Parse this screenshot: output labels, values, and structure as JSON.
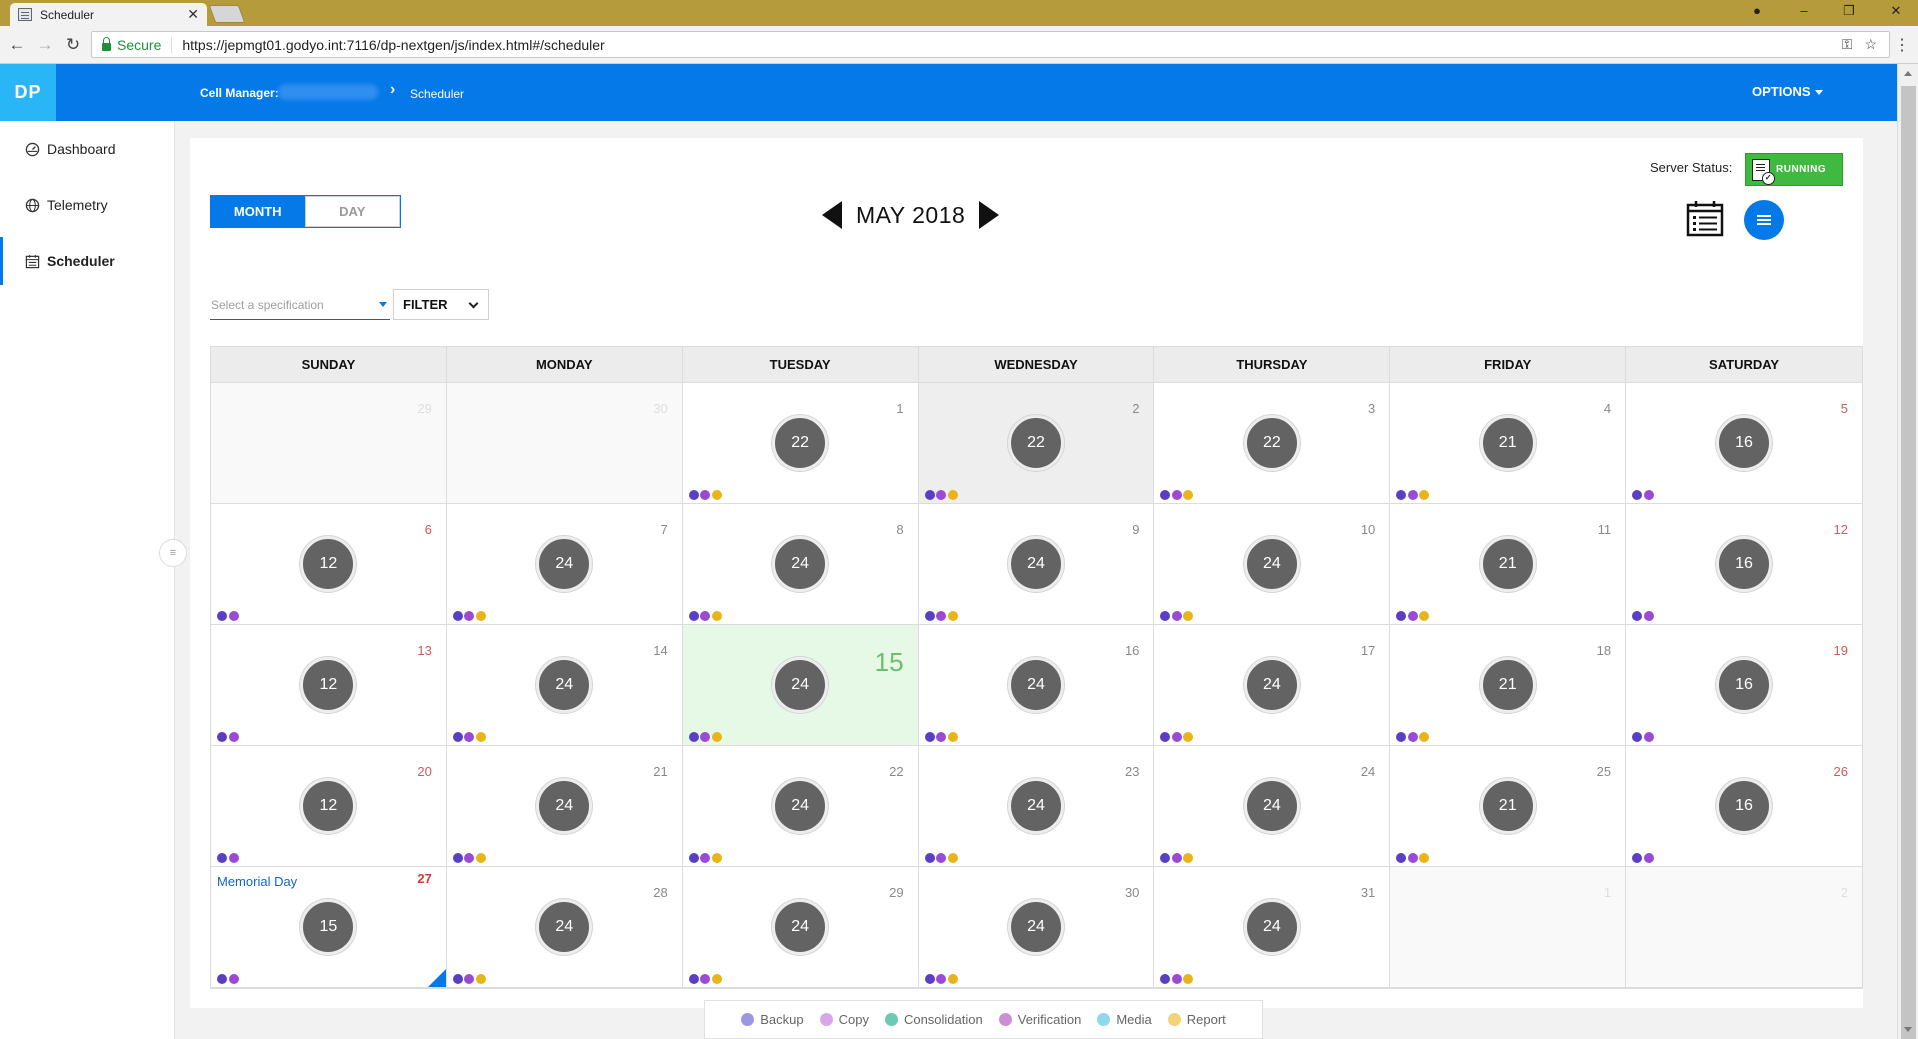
{
  "browser": {
    "tab_title": "Scheduler",
    "tab_close": "✕",
    "secure_label": "Secure",
    "url": "https://jepmgt01.godyo.int:7116/dp-nextgen/js/index.html#/scheduler"
  },
  "app": {
    "logo": "DP",
    "breadcrumb_label": "Cell Manager:",
    "breadcrumb_current": "Scheduler",
    "options_label": "OPTIONS"
  },
  "sidebar": {
    "items": [
      {
        "label": "Dashboard",
        "icon": "dashboard-icon"
      },
      {
        "label": "Telemetry",
        "icon": "globe-icon"
      },
      {
        "label": "Scheduler",
        "icon": "calendar-icon"
      }
    ]
  },
  "toolbar": {
    "month_label": "MONTH",
    "day_label": "DAY",
    "current_month": "MAY 2018",
    "spec_placeholder": "Select a specification",
    "filter_label": "FILTER",
    "server_status_label": "Server Status:",
    "server_status_value": "RUNNING"
  },
  "colors": {
    "backup": "#5a3fc4",
    "copy": "#9b4ad6",
    "report": "#e8b418",
    "accent": "#0579e8"
  },
  "calendar": {
    "weekdays": [
      "SUNDAY",
      "MONDAY",
      "TUESDAY",
      "WEDNESDAY",
      "THURSDAY",
      "FRIDAY",
      "SATURDAY"
    ],
    "days": [
      {
        "day": "29",
        "outside": true
      },
      {
        "day": "30",
        "outside": true
      },
      {
        "day": "1",
        "count": "22",
        "dots": [
          "backup",
          "copy",
          "report"
        ]
      },
      {
        "day": "2",
        "count": "22",
        "dots": [
          "backup",
          "copy",
          "report"
        ],
        "highlight": true
      },
      {
        "day": "3",
        "count": "22",
        "dots": [
          "backup",
          "copy",
          "report"
        ]
      },
      {
        "day": "4",
        "count": "21",
        "dots": [
          "backup",
          "copy",
          "report"
        ]
      },
      {
        "day": "5",
        "count": "16",
        "dots": [
          "backup",
          "copy"
        ],
        "weekend": true
      },
      {
        "day": "6",
        "count": "12",
        "dots": [
          "backup",
          "copy"
        ],
        "weekend": true
      },
      {
        "day": "7",
        "count": "24",
        "dots": [
          "backup",
          "copy",
          "report"
        ]
      },
      {
        "day": "8",
        "count": "24",
        "dots": [
          "backup",
          "copy",
          "report"
        ]
      },
      {
        "day": "9",
        "count": "24",
        "dots": [
          "backup",
          "copy",
          "report"
        ]
      },
      {
        "day": "10",
        "count": "24",
        "dots": [
          "backup",
          "copy",
          "report"
        ]
      },
      {
        "day": "11",
        "count": "21",
        "dots": [
          "backup",
          "copy",
          "report"
        ]
      },
      {
        "day": "12",
        "count": "16",
        "dots": [
          "backup",
          "copy"
        ],
        "weekend": true
      },
      {
        "day": "13",
        "count": "12",
        "dots": [
          "backup",
          "copy"
        ],
        "weekend": true
      },
      {
        "day": "14",
        "count": "24",
        "dots": [
          "backup",
          "copy",
          "report"
        ]
      },
      {
        "day": "15",
        "count": "24",
        "dots": [
          "backup",
          "copy",
          "report"
        ],
        "today": true
      },
      {
        "day": "16",
        "count": "24",
        "dots": [
          "backup",
          "copy",
          "report"
        ]
      },
      {
        "day": "17",
        "count": "24",
        "dots": [
          "backup",
          "copy",
          "report"
        ]
      },
      {
        "day": "18",
        "count": "21",
        "dots": [
          "backup",
          "copy",
          "report"
        ]
      },
      {
        "day": "19",
        "count": "16",
        "dots": [
          "backup",
          "copy"
        ],
        "weekend": true
      },
      {
        "day": "20",
        "count": "12",
        "dots": [
          "backup",
          "copy"
        ],
        "weekend": true
      },
      {
        "day": "21",
        "count": "24",
        "dots": [
          "backup",
          "copy",
          "report"
        ]
      },
      {
        "day": "22",
        "count": "24",
        "dots": [
          "backup",
          "copy",
          "report"
        ]
      },
      {
        "day": "23",
        "count": "24",
        "dots": [
          "backup",
          "copy",
          "report"
        ]
      },
      {
        "day": "24",
        "count": "24",
        "dots": [
          "backup",
          "copy",
          "report"
        ]
      },
      {
        "day": "25",
        "count": "21",
        "dots": [
          "backup",
          "copy",
          "report"
        ]
      },
      {
        "day": "26",
        "count": "16",
        "dots": [
          "backup",
          "copy"
        ],
        "weekend": true
      },
      {
        "day": "27",
        "count": "15",
        "dots": [
          "backup",
          "copy"
        ],
        "weekend": true,
        "holiday": "Memorial Day"
      },
      {
        "day": "28",
        "count": "24",
        "dots": [
          "backup",
          "copy",
          "report"
        ]
      },
      {
        "day": "29",
        "count": "24",
        "dots": [
          "backup",
          "copy",
          "report"
        ]
      },
      {
        "day": "30",
        "count": "24",
        "dots": [
          "backup",
          "copy",
          "report"
        ]
      },
      {
        "day": "31",
        "count": "24",
        "dots": [
          "backup",
          "copy",
          "report"
        ]
      },
      {
        "day": "1",
        "outside": true
      },
      {
        "day": "2",
        "outside": true
      }
    ]
  },
  "legend": [
    {
      "label": "Backup",
      "color": "#9a98e0"
    },
    {
      "label": "Copy",
      "color": "#d9a6ea"
    },
    {
      "label": "Consolidation",
      "color": "#6cc9b4"
    },
    {
      "label": "Verification",
      "color": "#cc8fd4"
    },
    {
      "label": "Media",
      "color": "#8fd8ec"
    },
    {
      "label": "Report",
      "color": "#f2d377"
    }
  ]
}
